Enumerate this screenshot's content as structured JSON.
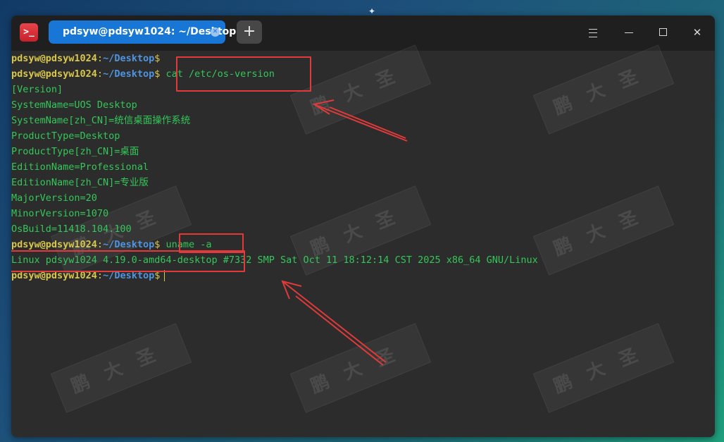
{
  "window": {
    "tab_title": "pdsyw@pdsyw1024: ~/Desktop",
    "new_tab_label": "+",
    "app_icon_glyph": ">_"
  },
  "terminal": {
    "prompt": {
      "user": "pdsyw@pdsyw1024",
      "colon": ":",
      "path": "~/Desktop",
      "dollar": "$"
    },
    "commands": [
      "",
      "cat /etc/os-version",
      "uname -a",
      ""
    ],
    "os_version_output": [
      "[Version]",
      "SystemName=UOS Desktop",
      "SystemName[zh_CN]=统信桌面操作系统",
      "ProductType=Desktop",
      "ProductType[zh_CN]=桌面",
      "EditionName=Professional",
      "EditionName[zh_CN]=专业版",
      "MajorVersion=20",
      "MinorVersion=1070",
      "OsBuild=11418.104.100"
    ],
    "uname_output_part1": "Linux pdsyw1024 4.19.0-amd64-desktop",
    "uname_output_part2": " #7332 SMP Sat Oct 11 18:12:14 CST 2025 x86_64 GNU/Linux"
  },
  "watermark": {
    "text": "鹏大圣"
  },
  "colors": {
    "accent_tab": "#1877d6",
    "prompt_user": "#d8c74b",
    "prompt_path": "#4e94df",
    "output_text": "#34c759",
    "annotation_red": "#e03a3a"
  }
}
